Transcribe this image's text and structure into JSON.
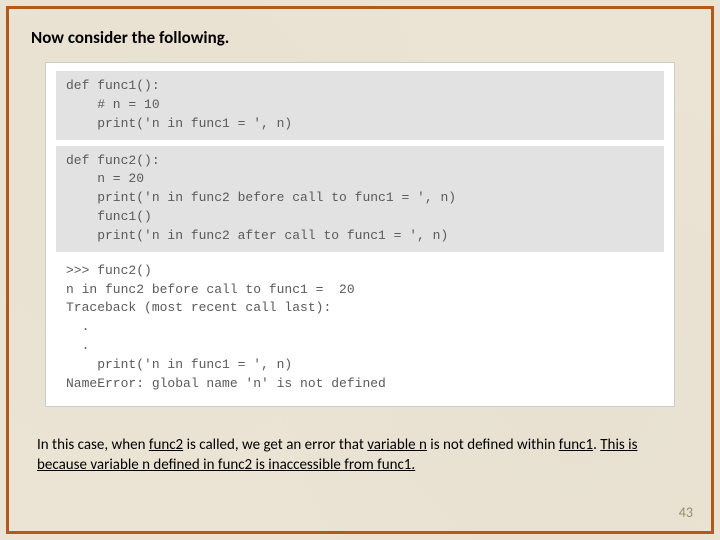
{
  "heading": "Now consider the following.",
  "code": {
    "block1": "def func1():\n    # n = 10\n    print('n in func1 = ', n)",
    "block2": "def func2():\n    n = 20\n    print('n in func2 before call to func1 = ', n)\n    func1()\n    print('n in func2 after call to func1 = ', n)",
    "output": ">>> func2()\nn in func2 before call to func1 =  20\nTraceback (most recent call last):\n  .\n  .\n    print('n in func1 = ', n)\nNameError: global name 'n' is not defined"
  },
  "explain": {
    "t1": "In this case, when ",
    "u1": "func2",
    "t2": " is called, we get an error that ",
    "u2": "variable n",
    "t3": " is not defined within ",
    "u3": "func1",
    "t4": ". ",
    "u4": "This is because variable n defined in func2 is inaccessible from func1.",
    "t5": ""
  },
  "page_number": "43"
}
